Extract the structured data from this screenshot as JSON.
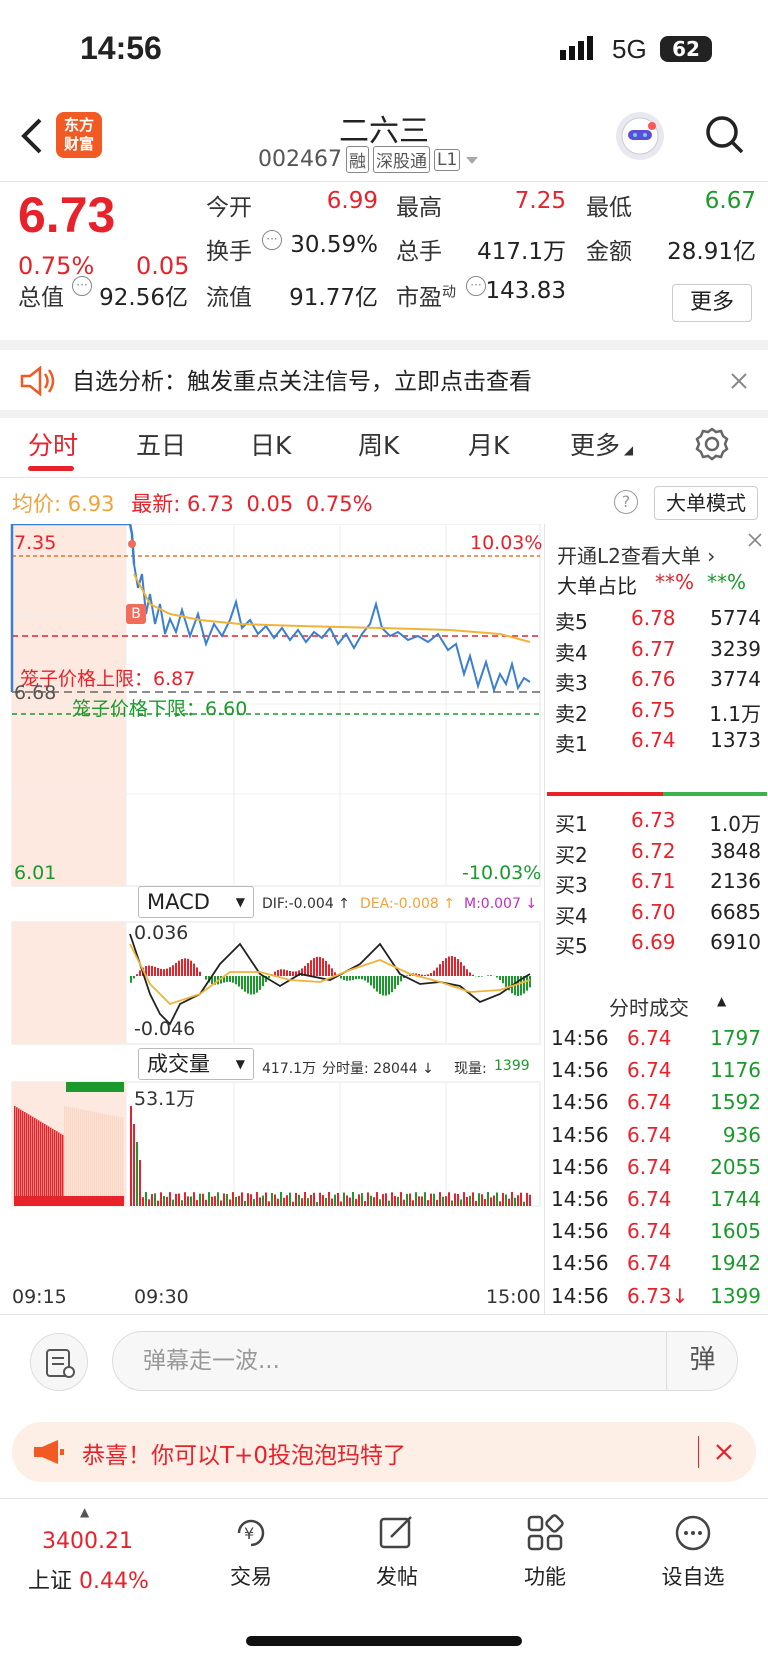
{
  "status": {
    "time": "14:56",
    "network": "5G",
    "battery": "62"
  },
  "header": {
    "logo": "东方\n财富",
    "title": "二六三",
    "code": "002467",
    "tags": [
      "融",
      "深股通",
      "L1"
    ]
  },
  "quote": {
    "price": "6.73",
    "pct": "0.75%",
    "chg": "0.05",
    "fields": [
      {
        "label": "今开",
        "value": "6.99",
        "color": "red"
      },
      {
        "label": "最高",
        "value": "7.25",
        "color": "red"
      },
      {
        "label": "最低",
        "value": "6.67",
        "color": "green"
      },
      {
        "label": "换手",
        "value": "30.59%",
        "color": "dark"
      },
      {
        "label": "总手",
        "value": "417.1万",
        "color": "dark"
      },
      {
        "label": "金额",
        "value": "28.91亿",
        "color": "dark"
      },
      {
        "label": "总值",
        "value": "92.56亿",
        "color": "dark"
      },
      {
        "label": "流值",
        "value": "91.77亿",
        "color": "dark"
      },
      {
        "label": "市盈",
        "value": "143.83",
        "color": "dark",
        "sup": "动"
      }
    ],
    "more": "更多"
  },
  "banner": {
    "text": "自选分析：触发重点关注信号，立即点击查看"
  },
  "tabs": [
    "分时",
    "五日",
    "日K",
    "周K",
    "月K",
    "更多"
  ],
  "info": {
    "avg_label": "均价:",
    "avg": "6.93",
    "latest_label": "最新:",
    "latest": "6.73",
    "chg": "0.05",
    "pct": "0.75%",
    "mode": "大单模式"
  },
  "chart": {
    "price_top": "7.35",
    "pct_top": "10.03%",
    "price_bottom": "6.01",
    "pct_bottom": "-10.03%",
    "price_mid": "6.68",
    "upper_limit": "笼子价格上限：6.87",
    "lower_limit": "笼子价格下限：6.60",
    "macd_label": "MACD",
    "dif": "DIF:-0.004 ↑",
    "dea": "DEA:-0.008 ↑",
    "m": "M:0.007 ↓",
    "macd_top": "0.036",
    "macd_bottom": "-0.046",
    "vol_label": "成交量",
    "vol_total": "417.1万",
    "vol_min_label": "分时量: 28044 ↓",
    "vol_now_label": "现量:",
    "vol_now": "1399",
    "vol_top": "53.1万",
    "t_start": "09:15",
    "t_open": "09:30",
    "t_end": "15:00",
    "b_marker": "B"
  },
  "orderbook": {
    "l2": "开通L2查看大单 ›",
    "big_ratio": "大单占比",
    "r1": "**%",
    "r2": "**%",
    "asks": [
      {
        "name": "卖5",
        "price": "6.78",
        "vol": "5774"
      },
      {
        "name": "卖4",
        "price": "6.77",
        "vol": "3239"
      },
      {
        "name": "卖3",
        "price": "6.76",
        "vol": "3774"
      },
      {
        "name": "卖2",
        "price": "6.75",
        "vol": "1.1万"
      },
      {
        "name": "卖1",
        "price": "6.74",
        "vol": "1373"
      }
    ],
    "bids": [
      {
        "name": "买1",
        "price": "6.73",
        "vol": "1.0万"
      },
      {
        "name": "买2",
        "price": "6.72",
        "vol": "3848"
      },
      {
        "name": "买3",
        "price": "6.71",
        "vol": "2136"
      },
      {
        "name": "买4",
        "price": "6.70",
        "vol": "6685"
      },
      {
        "name": "买5",
        "price": "6.69",
        "vol": "6910"
      }
    ],
    "trades_title": "分时成交",
    "trades": [
      {
        "t": "14:56",
        "p": "6.74",
        "v": "1797"
      },
      {
        "t": "14:56",
        "p": "6.74",
        "v": "1176"
      },
      {
        "t": "14:56",
        "p": "6.74",
        "v": "1592"
      },
      {
        "t": "14:56",
        "p": "6.74",
        "v": "936"
      },
      {
        "t": "14:56",
        "p": "6.74",
        "v": "2055"
      },
      {
        "t": "14:56",
        "p": "6.74",
        "v": "1744"
      },
      {
        "t": "14:56",
        "p": "6.74",
        "v": "1605"
      },
      {
        "t": "14:56",
        "p": "6.74",
        "v": "1942"
      },
      {
        "t": "14:56",
        "p": "6.73↓",
        "v": "1399"
      }
    ]
  },
  "danmaku": {
    "placeholder": "弹幕走一波...",
    "btn": "弹"
  },
  "promo": {
    "text": "恭喜！你可以T+0投泡泡玛特了"
  },
  "bottomnav": {
    "index_val": "3400.21",
    "index_name": "上证",
    "index_pct": "0.44%",
    "items": [
      "交易",
      "发帖",
      "功能",
      "设自选"
    ]
  }
}
